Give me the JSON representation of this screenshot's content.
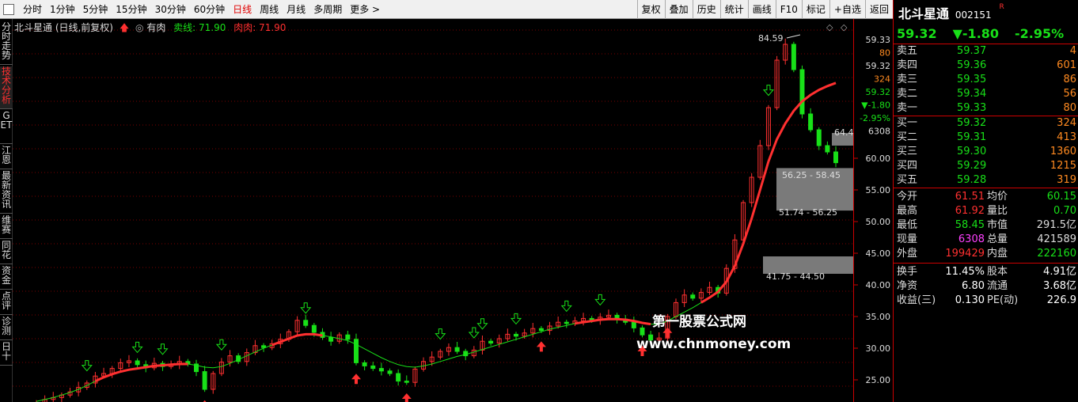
{
  "toolbar": {
    "periods": [
      "分时",
      "1分钟",
      "5分钟",
      "15分钟",
      "30分钟",
      "60分钟",
      "日线",
      "周线",
      "月线",
      "多周期",
      "更多 >"
    ],
    "active_period": "日线",
    "tools": [
      "复权",
      "叠加",
      "历史",
      "统计",
      "画线",
      "F10",
      "标记",
      "+自选",
      "返回"
    ]
  },
  "side_tabs": [
    "分时走势",
    "技术分析",
    "GET",
    "江恩",
    "最新资讯",
    "维赛",
    "同花",
    "资金",
    "点评",
    "诊测",
    "日十"
  ],
  "chart": {
    "title": "北斗星通 (日线,前复权)",
    "indicator_name": "有肉",
    "sell_label": "卖线: 71.90",
    "meat_label": "肉肉: 71.90",
    "high_label": "84.59",
    "box_labels": [
      "64.44",
      "56.25 - 58.45",
      "51.74 - 56.25",
      "41.75 - 44.50"
    ],
    "watermark_line1": "第一股票公式网",
    "watermark_line2": "www.chnmoney.com",
    "axis_ticks": [
      "60.00",
      "55.00",
      "50.00",
      "45.00",
      "40.00",
      "35.00",
      "30.00",
      "25.00"
    ],
    "axis_top_values": [
      "59.33",
      "80",
      "59.32",
      "324",
      "59.32",
      "▼-1.80",
      "-2.95%",
      "6308"
    ]
  },
  "chart_data": {
    "type": "candlestick",
    "ylim": [
      21.5,
      82
    ],
    "y_ticks": [
      25,
      30,
      35,
      40,
      45,
      50,
      55,
      60
    ],
    "closes": [
      21.4,
      21.9,
      22.2,
      22.6,
      23.1,
      23.8,
      24.5,
      25.6,
      26.0,
      26.8,
      27.7,
      28.0,
      27.4,
      26.9,
      27.6,
      27.1,
      27.4,
      27.9,
      27.5,
      26.3,
      23.5,
      26.0,
      27.8,
      28.8,
      27.9,
      29.3,
      30.4,
      30.1,
      30.7,
      31.4,
      32.6,
      34.4,
      33.6,
      32.5,
      31.7,
      31.1,
      32.1,
      31.4,
      27.7,
      27.2,
      26.8,
      26.4,
      26.0,
      24.8,
      24.6,
      26.7,
      27.9,
      28.6,
      29.5,
      30.1,
      29.5,
      28.8,
      29.7,
      31.1,
      30.8,
      31.5,
      32.2,
      31.9,
      32.4,
      33.1,
      32.8,
      33.5,
      34.1,
      33.9,
      34.3,
      34.7,
      34.4,
      34.9,
      35.2,
      34.6,
      34.1,
      33.2,
      32.1,
      31.3,
      31.6,
      35.0,
      37.2,
      38.4,
      37.9,
      38.8,
      39.6,
      38.7,
      42.6,
      47.1,
      53.0,
      57.0,
      62.0,
      68.0,
      75.5,
      78.0,
      74.0,
      67.0,
      64.5,
      62.0,
      61.0,
      59.3
    ],
    "sell_line": [
      21.6,
      21.9,
      22.2,
      22.6,
      23.0,
      23.5,
      24.1,
      24.8,
      25.4,
      25.9,
      26.3,
      26.6,
      26.8,
      27.0,
      27.2,
      27.3,
      27.4,
      27.5,
      27.5,
      27.3,
      27.0,
      26.9,
      27.1,
      27.6,
      28.2,
      28.8,
      29.4,
      30.0,
      30.5,
      31.0,
      31.5,
      32.0,
      32.2,
      32.2,
      32.0,
      31.8,
      31.5,
      31.2,
      30.6,
      29.9,
      29.2,
      28.5,
      27.9,
      27.4,
      27.1,
      27.0,
      27.2,
      27.5,
      27.9,
      28.3,
      28.7,
      29.0,
      29.4,
      29.8,
      30.2,
      30.6,
      31.0,
      31.4,
      31.8,
      32.2,
      32.6,
      33.0,
      33.3,
      33.6,
      33.9,
      34.1,
      34.3,
      34.5,
      34.6,
      34.6,
      34.5,
      34.3,
      34.0,
      33.8,
      33.8,
      34.3,
      35.0,
      35.7,
      36.4,
      37.2,
      38.0,
      38.9,
      40.5,
      43.0,
      46.5,
      50.5,
      55.0,
      59.5,
      63.0,
      65.5,
      67.5,
      69.0,
      70.0,
      70.8,
      71.4,
      71.9
    ],
    "red_segments": [
      [
        7,
        18
      ],
      [
        28,
        34
      ],
      [
        64,
        73
      ],
      [
        79,
        95
      ]
    ],
    "up_arrows": [
      20,
      38,
      44,
      60,
      72,
      75
    ],
    "down_arrows": [
      6,
      12,
      15,
      22,
      32,
      48,
      52,
      53,
      57,
      63,
      67,
      87
    ],
    "boxes": [
      [
        62.0,
        64.0
      ],
      [
        56.25,
        58.45
      ],
      [
        51.74,
        56.25
      ],
      [
        41.75,
        44.5
      ]
    ]
  },
  "quote": {
    "name": "北斗星通",
    "code": "002151",
    "flag": "R",
    "price": "59.32",
    "change": "▼-1.80",
    "pct": "-2.95%",
    "asks": [
      {
        "label": "卖五",
        "price": "59.37",
        "vol": "4"
      },
      {
        "label": "卖四",
        "price": "59.36",
        "vol": "601"
      },
      {
        "label": "卖三",
        "price": "59.35",
        "vol": "86"
      },
      {
        "label": "卖二",
        "price": "59.34",
        "vol": "56"
      },
      {
        "label": "卖一",
        "price": "59.33",
        "vol": "80"
      }
    ],
    "bids": [
      {
        "label": "买一",
        "price": "59.32",
        "vol": "324"
      },
      {
        "label": "买二",
        "price": "59.31",
        "vol": "413"
      },
      {
        "label": "买三",
        "price": "59.30",
        "vol": "1360"
      },
      {
        "label": "买四",
        "price": "59.29",
        "vol": "1215"
      },
      {
        "label": "买五",
        "price": "59.28",
        "vol": "319"
      }
    ],
    "stats1": [
      {
        "l1": "今开",
        "v1": "61.51",
        "c1": "red",
        "l2": "均价",
        "v2": "60.15",
        "c2": "green"
      },
      {
        "l1": "最高",
        "v1": "61.92",
        "c1": "red",
        "l2": "量比",
        "v2": "0.70",
        "c2": "green"
      },
      {
        "l1": "最低",
        "v1": "58.45",
        "c1": "green",
        "l2": "市值",
        "v2": "291.5亿",
        "c2": "cyan"
      },
      {
        "l1": "现量",
        "v1": "6308",
        "c1": "mag",
        "l2": "总量",
        "v2": "421589",
        "c2": "cyan"
      },
      {
        "l1": "外盘",
        "v1": "199429",
        "c1": "red",
        "l2": "内盘",
        "v2": "222160",
        "c2": "green"
      }
    ],
    "stats2": [
      {
        "l1": "换手",
        "v1": "11.45%",
        "c1": "white",
        "l2": "股本",
        "v2": "4.91亿",
        "c2": "white"
      },
      {
        "l1": "净资",
        "v1": "6.80",
        "c1": "white",
        "l2": "流通",
        "v2": "3.68亿",
        "c2": "white"
      },
      {
        "l1": "收益(三)",
        "v1": "0.130",
        "c1": "white",
        "l2": "PE(动)",
        "v2": "226.9",
        "c2": "white"
      }
    ]
  },
  "colors": {
    "up": "#ff3030",
    "down": "#18e018",
    "grid": "#7a0000",
    "background": "#000000"
  }
}
